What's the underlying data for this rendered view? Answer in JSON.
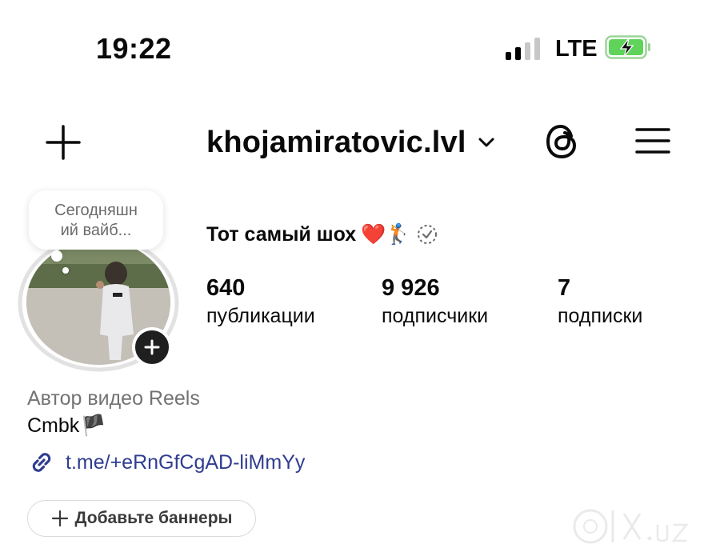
{
  "status_bar": {
    "time": "19:22",
    "network": "LTE",
    "signal_bars": 2,
    "battery_charging": true
  },
  "header": {
    "username": "khojamiratovic.lvl"
  },
  "note": {
    "text": "Сегодняшн\nий вайб..."
  },
  "profile": {
    "full_name": "Тот самый шох",
    "emoji": "❤️🏌️",
    "stats": [
      {
        "value": "640",
        "label": "публикации"
      },
      {
        "value": "9 926",
        "label": "подписчики"
      },
      {
        "value": "7",
        "label": "подписки"
      }
    ],
    "category": "Автор видео Reels",
    "bio": "Cmbk",
    "bio_flag": "🏴",
    "link": "t.me/+eRnGfCgAD-liMmYy",
    "banner_button": "Добавьте баннеры"
  },
  "watermark": {
    "text": "olx.uz"
  },
  "colors": {
    "link": "#2f3d8f",
    "battery": "#5fd35a",
    "muted": "#737373"
  }
}
